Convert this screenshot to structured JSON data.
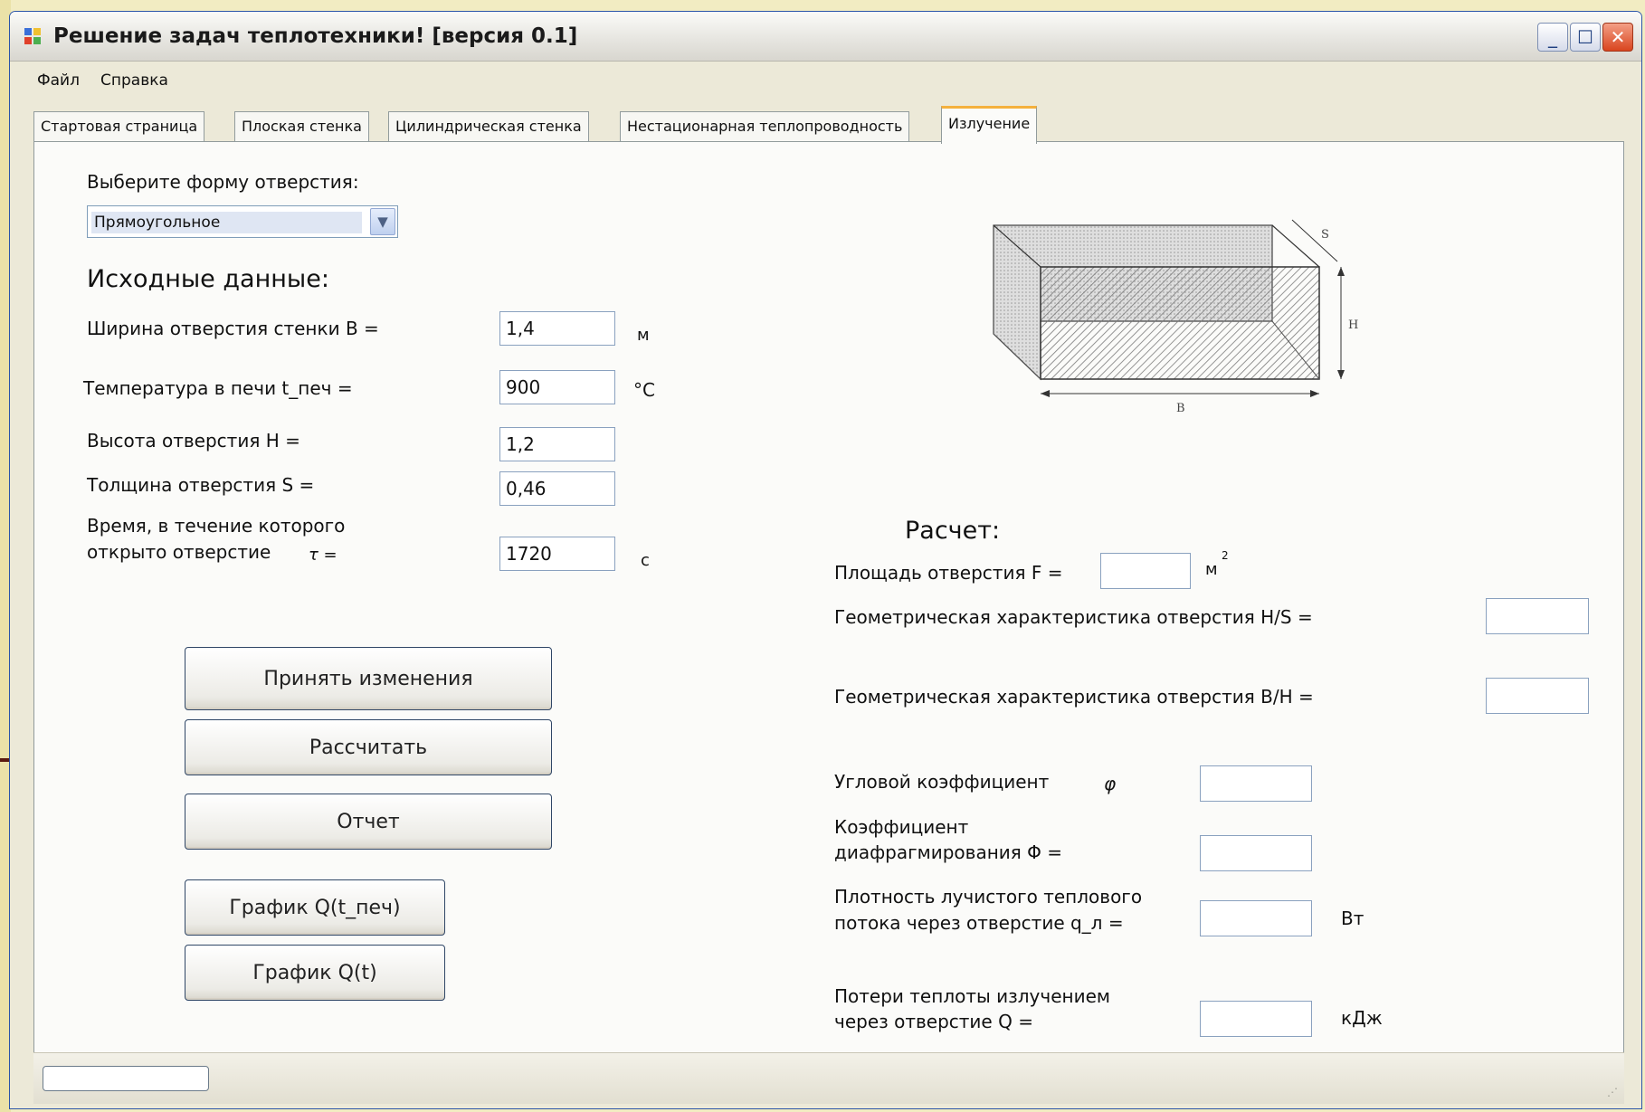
{
  "window": {
    "title": "Решение задач теплотехники! [версия 0.1]",
    "controls": {
      "minimize": "_",
      "maximize": "☐",
      "close": "✕"
    }
  },
  "menu": {
    "items": [
      "Файл",
      "Справка"
    ]
  },
  "tabs": [
    {
      "label": "Стартовая страница"
    },
    {
      "label": "Плоская стенка"
    },
    {
      "label": "Цилиндрическая стенка"
    },
    {
      "label": "Нестационарная теплопроводность"
    },
    {
      "label": "Излучение",
      "active": true
    }
  ],
  "shape": {
    "label": "Выберите форму отверстия:",
    "selected": "Прямоугольное"
  },
  "input": {
    "heading": "Исходные данные:",
    "width": {
      "label": "Ширина отверстия стенки B =",
      "value": "1,4",
      "unit": "м"
    },
    "temp": {
      "label": "Температура в печи t_печ =",
      "value": "900",
      "unit": "°C"
    },
    "height": {
      "label": "Высота отверстия H =",
      "value": "1,2"
    },
    "thick": {
      "label": "Толщина отверстия S =",
      "value": "0,46"
    },
    "time": {
      "label1": "Время, в течение которого",
      "label2": "открыто отверстие",
      "symbol": "τ =",
      "value": "1720",
      "unit": "с"
    }
  },
  "buttons": {
    "apply": "Принять изменения",
    "calc": "Рассчитать",
    "report": "Отчет",
    "graph_t": "График Q(t_печ)",
    "graph_time": "График Q(t)"
  },
  "diagram": {
    "label_s": "S",
    "label_h": "H",
    "label_b": "B"
  },
  "result": {
    "heading": "Расчет:",
    "area": {
      "label": "Площадь отверстия F =",
      "value": "",
      "unit": "м",
      "unit_sup": "2"
    },
    "hs": {
      "label": "Геометрическая характеристика отверстия H/S =",
      "value": ""
    },
    "bh": {
      "label": "Геометрическая характеристика отверстия B/H =",
      "value": ""
    },
    "angle": {
      "label": "Угловой коэффициент",
      "symbol": "φ",
      "value": ""
    },
    "diaph": {
      "label1": "Коэффициент",
      "label2": "диафрагмирования Φ =",
      "value": ""
    },
    "flux": {
      "label1": "Плотность лучистого теплового",
      "label2": "потока через отверстие q_л =",
      "value": "",
      "unit": "Вт"
    },
    "loss": {
      "label1": "Потери теплоты излучением",
      "label2": "через отверстие Q =",
      "value": "",
      "unit": "кДж"
    }
  },
  "status": {
    "progress": 0
  },
  "colors": {
    "accent_tab": "#f4b13d",
    "title_close": "#d9441e",
    "input_border": "#8aa1bf"
  }
}
